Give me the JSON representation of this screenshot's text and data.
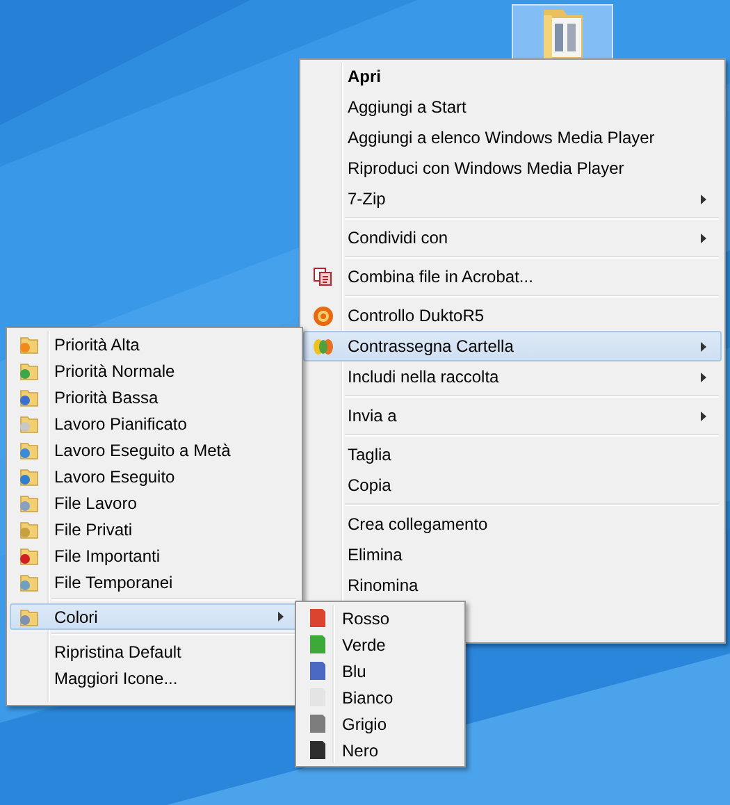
{
  "desktop_icon": {
    "selected": true
  },
  "context_menu": {
    "items": [
      {
        "kind": "item",
        "label": "Apri",
        "bold": true,
        "submenu": false,
        "selected": false
      },
      {
        "kind": "item",
        "label": "Aggiungi a Start",
        "bold": false,
        "submenu": false,
        "selected": false
      },
      {
        "kind": "item",
        "label": "Aggiungi a elenco Windows Media Player",
        "bold": false,
        "submenu": false,
        "selected": false
      },
      {
        "kind": "item",
        "label": "Riproduci con Windows Media Player",
        "bold": false,
        "submenu": false,
        "selected": false
      },
      {
        "kind": "item",
        "label": "7-Zip",
        "bold": false,
        "submenu": true,
        "selected": false
      },
      {
        "kind": "separator"
      },
      {
        "kind": "item",
        "label": "Condividi con",
        "bold": false,
        "submenu": true,
        "selected": false
      },
      {
        "kind": "separator"
      },
      {
        "kind": "item",
        "label": "Combina file in Acrobat...",
        "bold": false,
        "submenu": false,
        "selected": false
      },
      {
        "kind": "separator"
      },
      {
        "kind": "item",
        "label": "Controllo DuktoR5",
        "bold": false,
        "submenu": false,
        "selected": false
      },
      {
        "kind": "item",
        "label": "Contrassegna Cartella",
        "bold": false,
        "submenu": true,
        "selected": true
      },
      {
        "kind": "item",
        "label": "Includi nella raccolta",
        "bold": false,
        "submenu": true,
        "selected": false
      },
      {
        "kind": "separator"
      },
      {
        "kind": "item",
        "label": "Invia a",
        "bold": false,
        "submenu": true,
        "selected": false
      },
      {
        "kind": "separator"
      },
      {
        "kind": "item",
        "label": "Taglia",
        "bold": false,
        "submenu": false,
        "selected": false
      },
      {
        "kind": "item",
        "label": "Copia",
        "bold": false,
        "submenu": false,
        "selected": false
      },
      {
        "kind": "separator"
      },
      {
        "kind": "item",
        "label": "Crea collegamento",
        "bold": false,
        "submenu": false,
        "selected": false
      },
      {
        "kind": "item",
        "label": "Elimina",
        "bold": false,
        "submenu": false,
        "selected": false
      },
      {
        "kind": "item",
        "label": "Rinomina",
        "bold": false,
        "submenu": false,
        "selected": false
      }
    ]
  },
  "marker_submenu": {
    "items": [
      {
        "kind": "item",
        "label": "Priorità Alta",
        "submenu": false,
        "selected": false
      },
      {
        "kind": "item",
        "label": "Priorità Normale",
        "submenu": false,
        "selected": false
      },
      {
        "kind": "item",
        "label": "Priorità Bassa",
        "submenu": false,
        "selected": false
      },
      {
        "kind": "item",
        "label": "Lavoro Pianificato",
        "submenu": false,
        "selected": false
      },
      {
        "kind": "item",
        "label": "Lavoro Eseguito a Metà",
        "submenu": false,
        "selected": false
      },
      {
        "kind": "item",
        "label": "Lavoro Eseguito",
        "submenu": false,
        "selected": false
      },
      {
        "kind": "item",
        "label": "File Lavoro",
        "submenu": false,
        "selected": false
      },
      {
        "kind": "item",
        "label": "File Privati",
        "submenu": false,
        "selected": false
      },
      {
        "kind": "item",
        "label": "File Importanti",
        "submenu": false,
        "selected": false
      },
      {
        "kind": "item",
        "label": "File Temporanei",
        "submenu": false,
        "selected": false
      },
      {
        "kind": "separator"
      },
      {
        "kind": "item",
        "label": "Colori",
        "submenu": true,
        "selected": true
      },
      {
        "kind": "separator"
      },
      {
        "kind": "item",
        "label": "Ripristina Default",
        "submenu": false,
        "selected": false
      },
      {
        "kind": "item",
        "label": "Maggiori Icone...",
        "submenu": false,
        "selected": false
      }
    ]
  },
  "color_submenu": {
    "items": [
      {
        "label": "Rosso",
        "color": "#d9452e",
        "selected": false
      },
      {
        "label": "Verde",
        "color": "#3fa83a",
        "selected": false
      },
      {
        "label": "Blu",
        "color": "#4a68c0",
        "selected": false
      },
      {
        "label": "Bianco",
        "color": "#e4e4e4",
        "selected": false
      },
      {
        "label": "Grigio",
        "color": "#7d7d7d",
        "selected": false
      },
      {
        "label": "Nero",
        "color": "#2e2e2e",
        "selected": false
      }
    ]
  }
}
